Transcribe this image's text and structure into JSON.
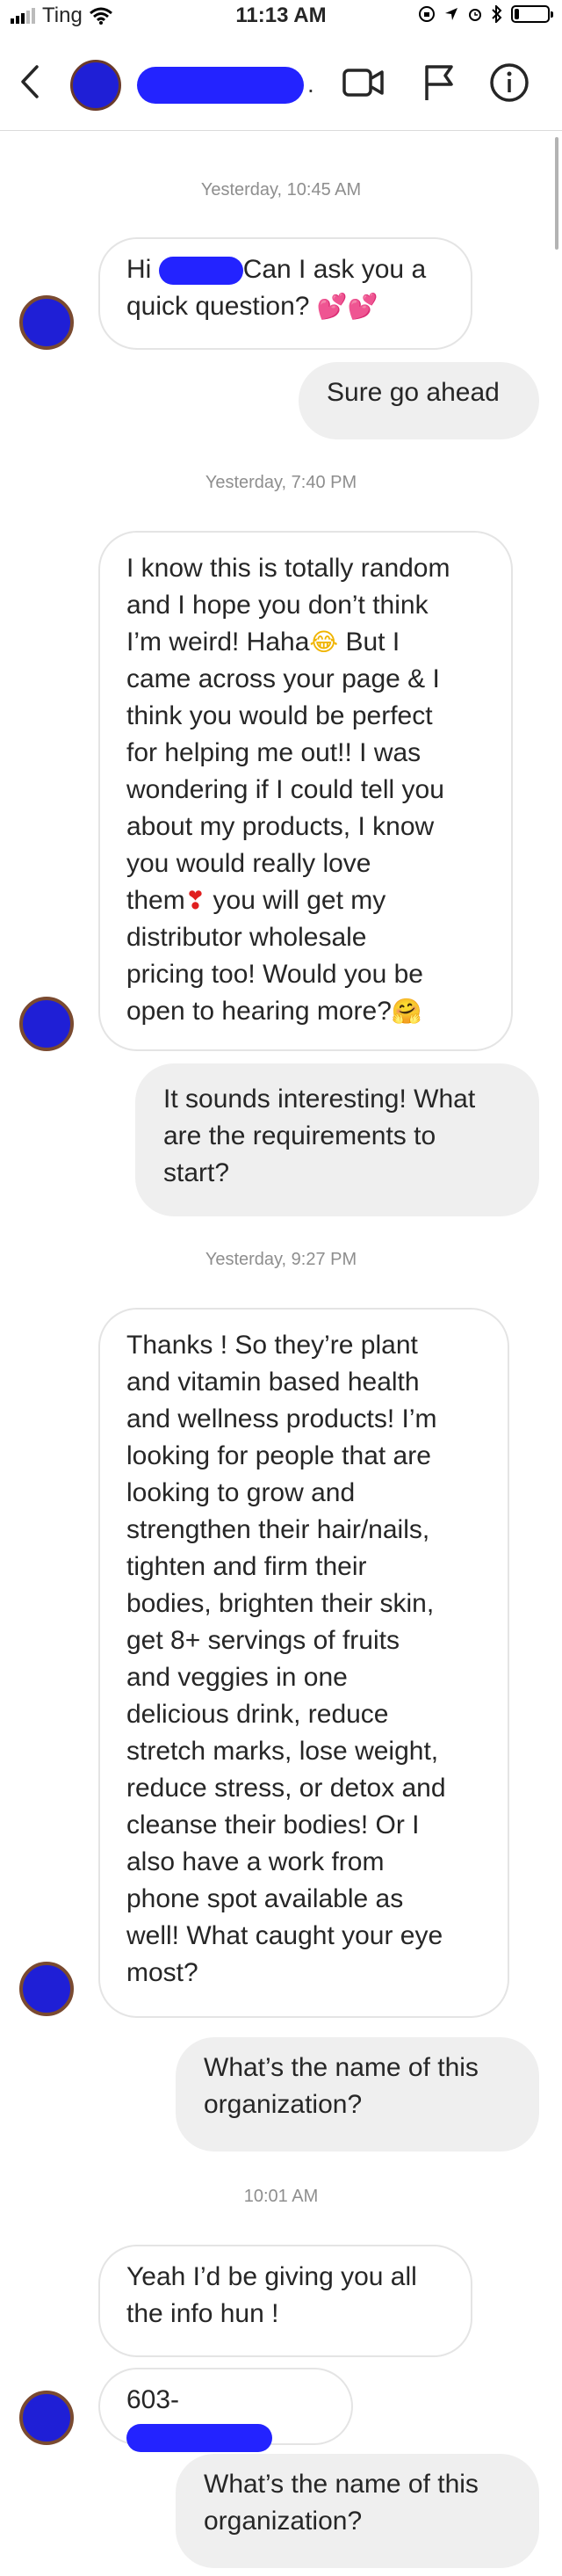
{
  "status_bar": {
    "carrier": "Ting",
    "time": "11:13 AM",
    "battery_level": 0.15
  },
  "header": {
    "contact_name": "████████",
    "icons": [
      "back-icon",
      "video-call-icon",
      "flag-icon",
      "info-icon"
    ]
  },
  "conversation": {
    "timestamps": [
      "Yesterday, 10:45 AM",
      "Yesterday, 7:40 PM",
      "Yesterday, 9:27 PM",
      "10:01 AM"
    ],
    "msg1": {
      "hi": "Hi",
      "redacted": "█████",
      "rest": "Can I ask you a\nquick question?",
      "emoji": "💕💕"
    },
    "msg2": "Sure go ahead",
    "msg3": {
      "part1": "I know this is totally random\nand I hope you don’t think\nI’m weird! Haha",
      "emoji1": "😂",
      "part2": " But I\ncame across your page & I\nthink you would be perfect\nfor helping me out!! I was\nwondering if I could tell you\nabout my products, I know\nyou would really love\nthem",
      "emoji2": "❣",
      "part3": " you will get my\ndistributor wholesale\npricing too! Would you be\nopen to hearing more?",
      "emoji3": "🤗"
    },
    "msg4": "It sounds interesting! What\nare the requirements to\nstart?",
    "msg5": "Thanks ! So they’re plant\nand vitamin based health\nand wellness products! I’m\nlooking for people that are\nlooking to grow and\nstrengthen their hair/nails,\ntighten and firm their\nbodies, brighten their skin,\nget 8+ servings of fruits\nand veggies in one\ndelicious drink, reduce\nstretch marks, lose weight,\nreduce stress, or detox and\ncleanse their bodies! Or I\nalso have a work from\nphone spot available as\nwell! What caught your eye\nmost?",
    "msg6": "What’s the name of this\norganization?",
    "msg7": "Yeah I’d be giving you all\nthe info hun !",
    "msg8": {
      "prefix": "603-",
      "redacted": "███████"
    },
    "msg9": "What’s the name of this\norganization?"
  }
}
